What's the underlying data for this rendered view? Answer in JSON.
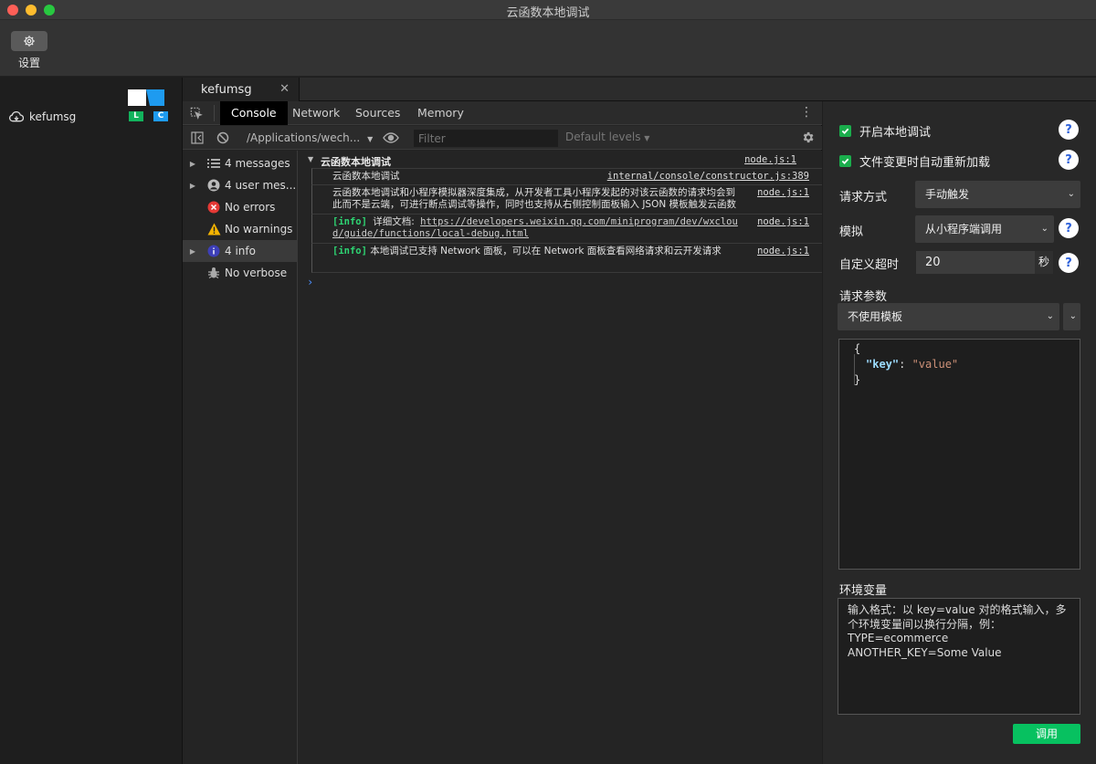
{
  "window": {
    "title": "云函数本地调试"
  },
  "toolbar": {
    "settings_label": "设置"
  },
  "sidebar": {
    "function_name": "kefumsg",
    "badge_l": "L",
    "badge_c": "C"
  },
  "editor_tabs": [
    {
      "label": "kefumsg",
      "close": "✕"
    }
  ],
  "devtools": {
    "tabs": [
      "Console",
      "Network",
      "Sources",
      "Memory"
    ],
    "context": "/Applications/wech...",
    "filter_placeholder": "Filter",
    "levels": "Default levels",
    "sidebar_items": [
      {
        "label": "4 messages",
        "icon": "list-icon",
        "expandable": true
      },
      {
        "label": "4 user mes...",
        "icon": "user-icon",
        "expandable": true
      },
      {
        "label": "No errors",
        "icon": "error-icon",
        "expandable": false
      },
      {
        "label": "No warnings",
        "icon": "warning-icon",
        "expandable": false
      },
      {
        "label": "4 info",
        "icon": "info-icon",
        "expandable": true
      },
      {
        "label": "No verbose",
        "icon": "bug-icon",
        "expandable": false
      }
    ],
    "console": {
      "group_title": "云函数本地调试",
      "group_source": "node.js:1",
      "messages": [
        {
          "text": "云函数本地调试",
          "source": "internal/console/constructor.js:389"
        },
        {
          "text": "云函数本地调试和小程序模拟器深度集成，从开发者工具小程序发起的对该云函数的请求均会到此而不是云端，可进行断点调试等操作，同时也支持从右侧控制面板输入 JSON 模板触发云函数",
          "source": "node.js:1"
        },
        {
          "tag": "[info]",
          "text": "详细文档:",
          "link": "https://developers.weixin.qq.com/miniprogram/dev/wxcloud/guide/functions/local-debug.html",
          "source": "node.js:1"
        },
        {
          "tag": "[info]",
          "text": "本地调试已支持 Network 面板，可以在 Network 面板查看网络请求和云开发请求",
          "source": "node.js:1"
        }
      ],
      "prompt": "›"
    }
  },
  "panel": {
    "enable_local_debug": "开启本地调试",
    "auto_reload": "文件变更时自动重新加载",
    "request_method_label": "请求方式",
    "request_method_value": "手动触发",
    "simulate_label": "模拟",
    "simulate_value": "从小程序端调用",
    "timeout_label": "自定义超时",
    "timeout_value": "20",
    "timeout_unit": "秒",
    "params_label": "请求参数",
    "template_value": "不使用模板",
    "json": {
      "open": "{",
      "key": "\"key\"",
      "colon": ": ",
      "value": "\"value\"",
      "close": "}"
    },
    "env_label": "环境变量",
    "env_placeholder_lines": [
      "输入格式：以 key=value 对的格式输入，多个环境变量间以换行分隔，例：",
      "TYPE=ecommerce",
      "ANOTHER_KEY=Some Value"
    ],
    "apply_label": "调用",
    "help": "?"
  },
  "colors": {
    "accent_green": "#07c160",
    "checkbox_green": "#1aad4c",
    "link_blue": "#1e9bf0"
  }
}
